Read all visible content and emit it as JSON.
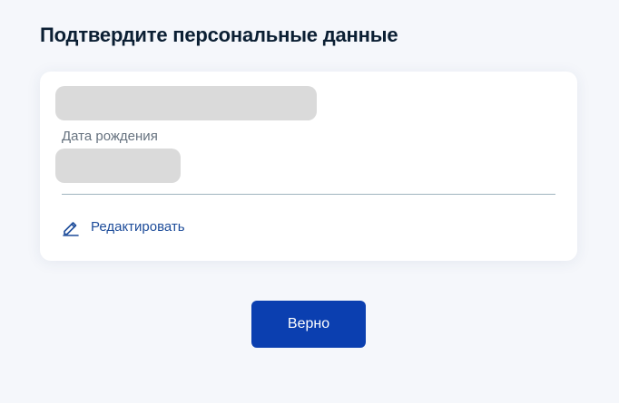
{
  "page": {
    "title": "Подтвердите персональные данные"
  },
  "personal_data": {
    "full_name": "",
    "birth_date_label": "Дата рождения",
    "birth_date": ""
  },
  "actions": {
    "edit_label": "Редактировать",
    "edit_icon": "pencil-icon",
    "confirm_label": "Верно"
  },
  "colors": {
    "background": "#f5f7fb",
    "card": "#ffffff",
    "redacted_placeholder": "#dadada",
    "accent_link": "#1d4c9a",
    "primary_button": "#0b3fb0",
    "title_text": "#0b1f33",
    "label_text": "#66727f"
  }
}
